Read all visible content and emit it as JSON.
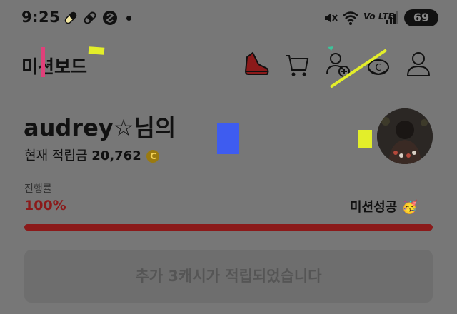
{
  "status_bar": {
    "time": "9:25",
    "network": "Vo LTE",
    "battery": "69"
  },
  "header": {
    "title": "미션보드",
    "icons": [
      "sneaker-icon",
      "cart-icon",
      "add-friend-icon",
      "coin-icon",
      "profile-icon"
    ]
  },
  "user": {
    "name": "audrey☆님의",
    "points_label": "현재 적립금",
    "points_value": "20,762",
    "coin_symbol": "C"
  },
  "progress": {
    "label": "진행률",
    "value_text": "100%",
    "percent": 100,
    "status": "미션성공 🥳"
  },
  "notice": {
    "text": "추가 3캐시가 적립되었습니다"
  },
  "colors": {
    "background": "#777777",
    "accent": "#8b1a1a",
    "highlight_yellow": "#e3ee2a",
    "highlight_blue": "#3e5cf0",
    "highlight_pink": "#e0407a"
  }
}
